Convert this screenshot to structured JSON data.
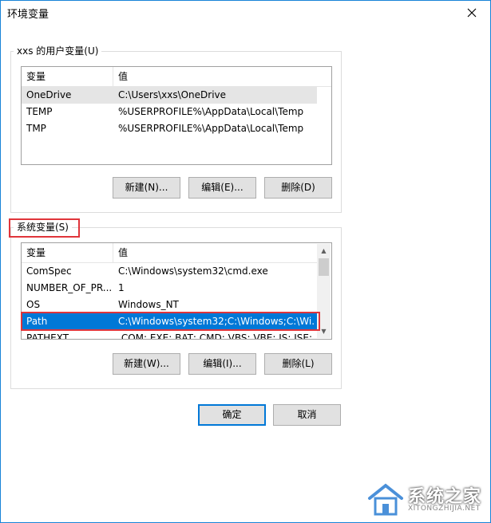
{
  "window": {
    "title": "环境变量"
  },
  "user_vars": {
    "group_label": "xxs 的用户变量(U)",
    "headers": {
      "name": "变量",
      "value": "值"
    },
    "rows": [
      {
        "name": "OneDrive",
        "value": "C:\\Users\\xxs\\OneDrive"
      },
      {
        "name": "TEMP",
        "value": "%USERPROFILE%\\AppData\\Local\\Temp"
      },
      {
        "name": "TMP",
        "value": "%USERPROFILE%\\AppData\\Local\\Temp"
      }
    ],
    "buttons": {
      "new": "新建(N)...",
      "edit": "编辑(E)...",
      "delete": "删除(D)"
    }
  },
  "system_vars": {
    "group_label": "系统变量(S)",
    "headers": {
      "name": "变量",
      "value": "值"
    },
    "rows": [
      {
        "name": "ComSpec",
        "value": "C:\\Windows\\system32\\cmd.exe"
      },
      {
        "name": "NUMBER_OF_PR...",
        "value": "1"
      },
      {
        "name": "OS",
        "value": "Windows_NT"
      },
      {
        "name": "Path",
        "value": "C:\\Windows\\system32;C:\\Windows;C:\\Wi..."
      },
      {
        "name": "PATHEXT",
        "value": ".COM;.EXE;.BAT;.CMD;.VBS;.VBE;.JS;.JSE;..."
      }
    ],
    "buttons": {
      "new": "新建(W)...",
      "edit": "编辑(I)...",
      "delete": "删除(L)"
    }
  },
  "footer": {
    "ok": "确定",
    "cancel": "取消"
  },
  "watermark": {
    "text": "系统之家",
    "sub": "XITONGZHIJIA.NET"
  }
}
